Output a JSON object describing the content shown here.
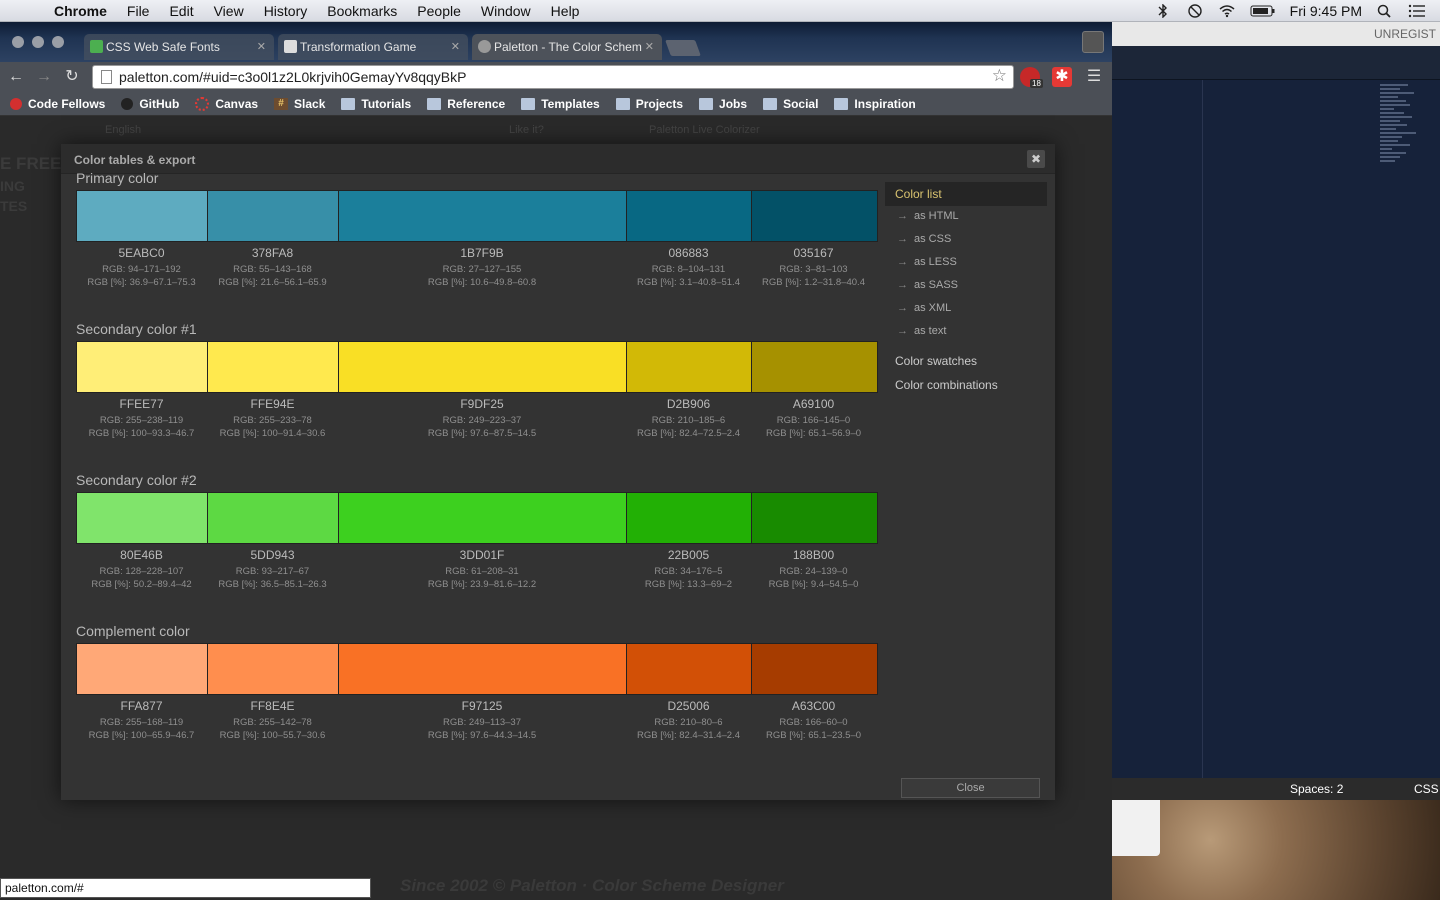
{
  "menubar": {
    "app": "Chrome",
    "items": [
      "File",
      "Edit",
      "View",
      "History",
      "Bookmarks",
      "People",
      "Window",
      "Help"
    ],
    "clock": "Fri 9:45 PM"
  },
  "tabs": [
    {
      "label": "CSS Web Safe Fonts",
      "favicon_color": "#4caf50"
    },
    {
      "label": "Transformation Game",
      "favicon_color": "#dddddd"
    },
    {
      "label": "Paletton - The Color Schem",
      "favicon_color": "#999999"
    }
  ],
  "address": {
    "url": "paletton.com/#uid=c3o0l1z2L0krjvih0GemayYv8qqyBkP"
  },
  "extensions": {
    "badge": "18"
  },
  "bookmarks": [
    {
      "label": "Code Fellows",
      "icon": "code-fellows-icon"
    },
    {
      "label": "GitHub",
      "icon": "github-icon"
    },
    {
      "label": "Canvas",
      "icon": "canvas-icon"
    },
    {
      "label": "Slack",
      "icon": "slack-icon"
    },
    {
      "label": "Tutorials",
      "icon": "folder-icon"
    },
    {
      "label": "Reference",
      "icon": "folder-icon"
    },
    {
      "label": "Templates",
      "icon": "folder-icon"
    },
    {
      "label": "Projects",
      "icon": "folder-icon"
    },
    {
      "label": "Jobs",
      "icon": "folder-icon"
    },
    {
      "label": "Social",
      "icon": "folder-icon"
    },
    {
      "label": "Inspiration",
      "icon": "folder-icon"
    }
  ],
  "page_nav": {
    "language": "English",
    "like": "Like it?",
    "live": "Paletton Live Colorizer"
  },
  "modal": {
    "title": "Color tables & export",
    "close_x": "✖",
    "close_label": "Close",
    "sections": [
      {
        "title": "Primary color",
        "colors": [
          {
            "hex": "5EABC0",
            "rgb": "RGB: 94–171–192",
            "pct": "RGB [%]: 36.9–67.1–75.3",
            "color": "#5EABC0"
          },
          {
            "hex": "378FA8",
            "rgb": "RGB: 55–143–168",
            "pct": "RGB [%]: 21.6–56.1–65.9",
            "color": "#378FA8"
          },
          {
            "hex": "1B7F9B",
            "rgb": "RGB: 27–127–155",
            "pct": "RGB [%]: 10.6–49.8–60.8",
            "color": "#1B7F9B"
          },
          {
            "hex": "086883",
            "rgb": "RGB: 8–104–131",
            "pct": "RGB [%]: 3.1–40.8–51.4",
            "color": "#086883"
          },
          {
            "hex": "035167",
            "rgb": "RGB: 3–81–103",
            "pct": "RGB [%]: 1.2–31.8–40.4",
            "color": "#035167"
          }
        ]
      },
      {
        "title": "Secondary color #1",
        "colors": [
          {
            "hex": "FFEE77",
            "rgb": "RGB: 255–238–119",
            "pct": "RGB [%]: 100–93.3–46.7",
            "color": "#FFEE77"
          },
          {
            "hex": "FFE94E",
            "rgb": "RGB: 255–233–78",
            "pct": "RGB [%]: 100–91.4–30.6",
            "color": "#FFE94E"
          },
          {
            "hex": "F9DF25",
            "rgb": "RGB: 249–223–37",
            "pct": "RGB [%]: 97.6–87.5–14.5",
            "color": "#F9DF25"
          },
          {
            "hex": "D2B906",
            "rgb": "RGB: 210–185–6",
            "pct": "RGB [%]: 82.4–72.5–2.4",
            "color": "#D2B906"
          },
          {
            "hex": "A69100",
            "rgb": "RGB: 166–145–0",
            "pct": "RGB [%]: 65.1–56.9–0",
            "color": "#A69100"
          }
        ]
      },
      {
        "title": "Secondary color #2",
        "colors": [
          {
            "hex": "80E46B",
            "rgb": "RGB: 128–228–107",
            "pct": "RGB [%]: 50.2–89.4–42",
            "color": "#80E46B"
          },
          {
            "hex": "5DD943",
            "rgb": "RGB: 93–217–67",
            "pct": "RGB [%]: 36.5–85.1–26.3",
            "color": "#5DD943"
          },
          {
            "hex": "3DD01F",
            "rgb": "RGB: 61–208–31",
            "pct": "RGB [%]: 23.9–81.6–12.2",
            "color": "#3DD01F"
          },
          {
            "hex": "22B005",
            "rgb": "RGB: 34–176–5",
            "pct": "RGB [%]: 13.3–69–2",
            "color": "#22B005"
          },
          {
            "hex": "188B00",
            "rgb": "RGB: 24–139–0",
            "pct": "RGB [%]: 9.4–54.5–0",
            "color": "#188B00"
          }
        ]
      },
      {
        "title": "Complement color",
        "colors": [
          {
            "hex": "FFA877",
            "rgb": "RGB: 255–168–119",
            "pct": "RGB [%]: 100–65.9–46.7",
            "color": "#FFA877"
          },
          {
            "hex": "FF8E4E",
            "rgb": "RGB: 255–142–78",
            "pct": "RGB [%]: 100–55.7–30.6",
            "color": "#FF8E4E"
          },
          {
            "hex": "F97125",
            "rgb": "RGB: 249–113–37",
            "pct": "RGB [%]: 97.6–44.3–14.5",
            "color": "#F97125"
          },
          {
            "hex": "D25006",
            "rgb": "RGB: 210–80–6",
            "pct": "RGB [%]: 82.4–31.4–2.4",
            "color": "#D25006"
          },
          {
            "hex": "A63C00",
            "rgb": "RGB: 166–60–0",
            "pct": "RGB [%]: 65.1–23.5–0",
            "color": "#A63C00"
          }
        ]
      }
    ],
    "sidebar": {
      "active": "Color list",
      "subitems": [
        "as HTML",
        "as CSS",
        "as LESS",
        "as SASS",
        "as XML",
        "as text"
      ],
      "main_items": [
        "Color swatches",
        "Color combinations"
      ]
    }
  },
  "status_url": "paletton.com/#",
  "editor": {
    "unregistered": "UNREGIST",
    "spaces": "Spaces: 2",
    "syntax": "CSS"
  },
  "footer_ghost": "Since 2002 © Paletton · Color Scheme Designer"
}
